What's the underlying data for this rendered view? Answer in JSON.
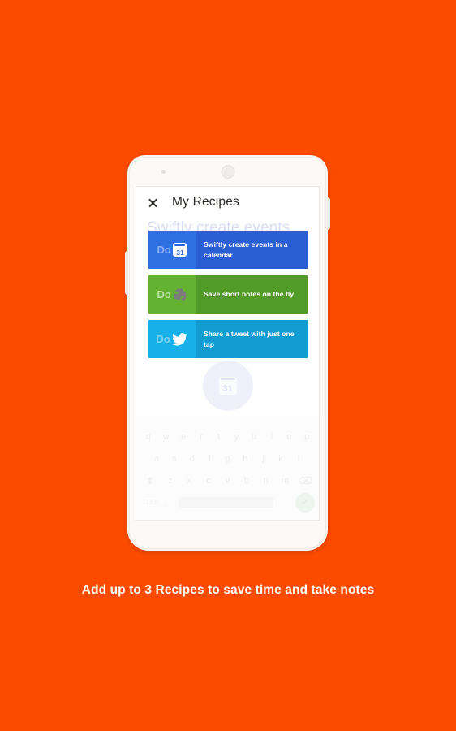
{
  "background_color": "#FA4B00",
  "caption": "Add up to 3 Recipes to save time and take notes",
  "phone": {
    "camera_icon": "camera-dot",
    "speaker_icon": "speaker-grille"
  },
  "app": {
    "close_icon": "close-icon",
    "title": "My Recipes",
    "ghost_heading": "Swiftly create events",
    "recipes": [
      {
        "badge_text": "Do",
        "icon": "calendar-icon",
        "icon_day": "31",
        "label": "Swiftly create events in a calendar",
        "badge_color": "#2F6FE4",
        "body_color": "#2A5FD3",
        "badge_text_color": "#8FB3F0"
      },
      {
        "badge_text": "Do",
        "icon": "evernote-elephant-icon",
        "label": "Save short notes on the fly",
        "badge_color": "#64B232",
        "body_color": "#529B28",
        "badge_text_color": "#BBDFA4"
      },
      {
        "badge_text": "Do",
        "icon": "twitter-bird-icon",
        "label": "Share a tweet with just one tap",
        "badge_color": "#18B0E8",
        "body_color": "#129CD2",
        "badge_text_color": "#7FD0EE"
      }
    ],
    "ghost_app_icon": "calendar-icon",
    "ghost_app_icon_day": "31"
  },
  "keyboard": {
    "row1": [
      "q",
      "w",
      "e",
      "r",
      "t",
      "y",
      "u",
      "i",
      "o",
      "p"
    ],
    "row2": [
      "a",
      "s",
      "d",
      "f",
      "g",
      "h",
      "j",
      "k",
      "l"
    ],
    "row3": [
      "z",
      "x",
      "c",
      "v",
      "b",
      "n",
      "m"
    ],
    "shift_icon": "shift-icon",
    "backspace_icon": "backspace-icon",
    "numeric_key": "?123",
    "comma_key": ",",
    "period_key": ".",
    "send_icon": "send-check-icon"
  }
}
